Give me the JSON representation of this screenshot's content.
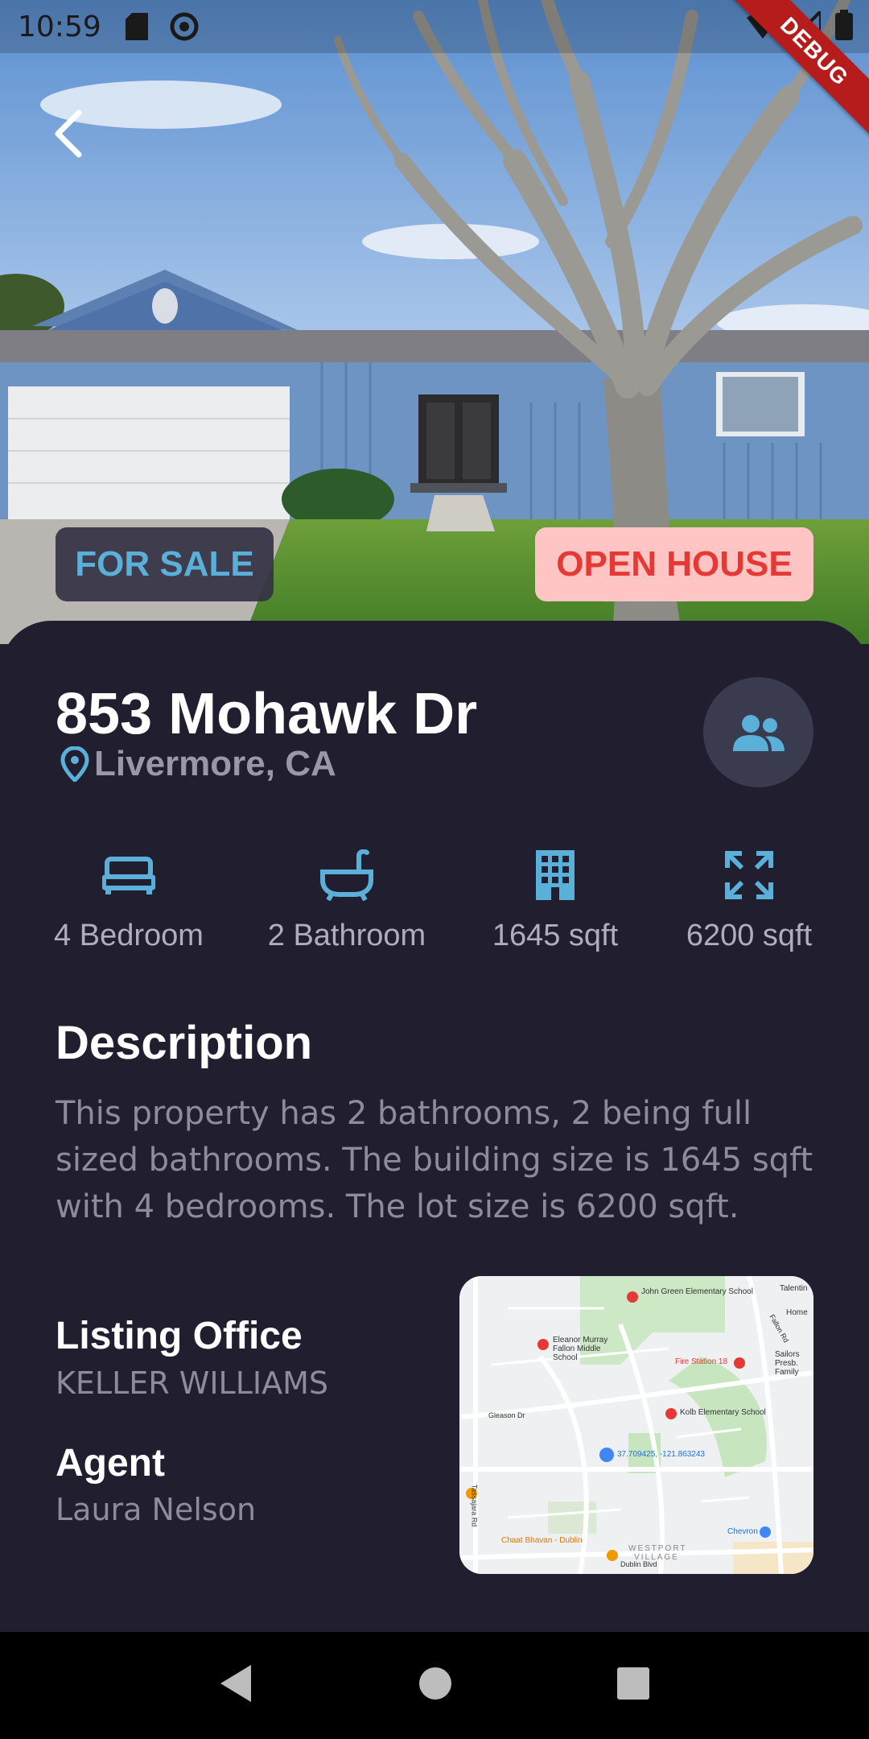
{
  "status_bar": {
    "time": "10:59",
    "debug_label": "DEBUG"
  },
  "listing": {
    "status_badge": "FOR SALE",
    "open_house_badge": "OPEN HOUSE",
    "address": "853 Mohawk Dr",
    "city": "Livermore, CA"
  },
  "features": [
    {
      "icon": "bed-icon",
      "label": "4 Bedroom"
    },
    {
      "icon": "bathtub-icon",
      "label": "2 Bathroom"
    },
    {
      "icon": "building-icon",
      "label": "1645 sqft"
    },
    {
      "icon": "expand-icon",
      "label": "6200 sqft"
    }
  ],
  "description": {
    "title": "Description",
    "text": "This property has 2 bathrooms, 2 being full sized bathrooms. The building size is 1645 sqft with 4 bedrooms. The lot size is 6200 sqft."
  },
  "listing_office": {
    "title": "Listing Office",
    "value": "KELLER WILLIAMS"
  },
  "agent": {
    "title": "Agent",
    "value": "Laura Nelson"
  },
  "map": {
    "labels": {
      "school1": "John Green Elementary School",
      "school2": "Eleanor Murray Fallon Middle School",
      "fire": "Fire Station 18",
      "school3": "Kolb Elementary School",
      "coords": "37.709425, -121.863243",
      "chevron": "Chevron",
      "restaurant": "Chaat Bhavan - Dublin",
      "village": "WESTPORT VILLAGE",
      "street1": "Dublin Blvd",
      "street2": "Gleason Dr",
      "street3": "Fallon Rd",
      "street4": "Tassajara Rd",
      "place1": "Talentin",
      "place2": "Home",
      "place3": "Sailors Presb. Family"
    }
  },
  "colors": {
    "accent": "#5ab0d8",
    "background": "#211e2f",
    "open_house": "#e53935"
  }
}
